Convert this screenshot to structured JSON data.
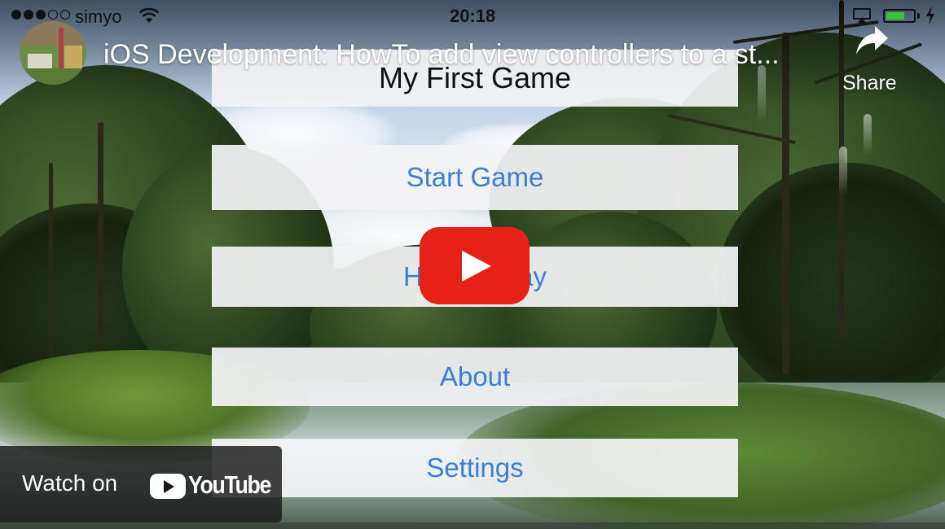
{
  "status_bar": {
    "carrier": "simyo",
    "time": "20:18",
    "signal_bars_filled": 3,
    "signal_bars_total": 5,
    "battery_level": 0.7,
    "battery_color": "#3cc13c",
    "icons": [
      "wifi-icon",
      "airplay-icon",
      "battery-icon",
      "charging-icon"
    ]
  },
  "video": {
    "title": "iOS Development: HowTo add view controllers to a st...",
    "share_label": "Share",
    "watch_on_label": "Watch on",
    "platform_name": "YouTube",
    "accent_color": "#e62117"
  },
  "game_menu": {
    "title": "My First Game",
    "buttons": [
      "Start Game",
      "How to Play",
      "About",
      "Settings"
    ],
    "button_text_color": "#3a7fd1"
  }
}
